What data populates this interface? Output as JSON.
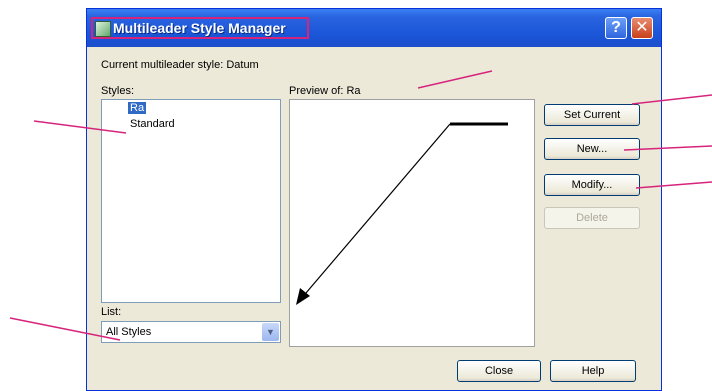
{
  "window": {
    "title": "Multileader Style Manager",
    "help_glyph": "?",
    "close_glyph": "✕"
  },
  "current_style": {
    "label": "Current multileader style: Datum"
  },
  "styles": {
    "label": "Styles:",
    "items": [
      {
        "label": "Ra",
        "selected": true
      },
      {
        "label": "Standard",
        "selected": false
      }
    ]
  },
  "list": {
    "label": "List:",
    "value": "All Styles"
  },
  "preview": {
    "label": "Preview of: Ra"
  },
  "buttons": {
    "set_current": "Set Current",
    "new": "New...",
    "modify": "Modify...",
    "delete": "Delete",
    "close": "Close",
    "help": "Help"
  },
  "colors": {
    "callout": "#d6247c",
    "titlebar": "#2a64e0",
    "selection": "#316ac5",
    "dialog_bg": "#ece9d8"
  }
}
